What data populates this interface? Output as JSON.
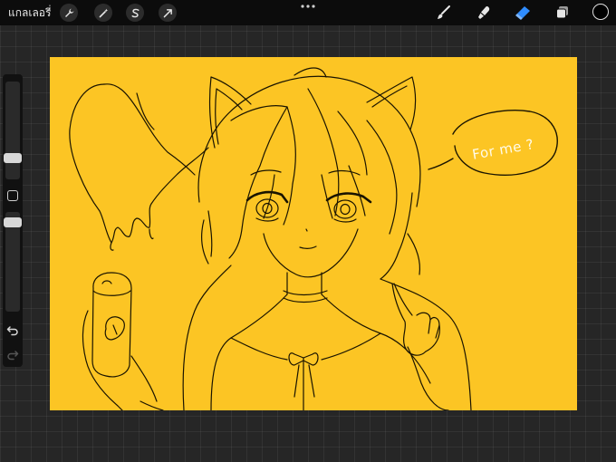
{
  "app": {
    "gallery_label": "แกลเลอรี่"
  },
  "toolbar": {
    "left_icons": [
      "wrench-icon",
      "magic-wand-icon",
      "selection-s-icon",
      "transform-arrow-icon"
    ],
    "right_icons": [
      "brush-icon",
      "smudge-icon",
      "eraser-icon",
      "layers-icon"
    ],
    "active_tool": "eraser",
    "accent_color": "#2f8cff",
    "current_color": "#000000"
  },
  "sidebar": {
    "brush_size_level": 0.5,
    "opacity_level": 0.5
  },
  "canvas": {
    "background_color": "#fcc524",
    "speech_text": "For me ?"
  }
}
